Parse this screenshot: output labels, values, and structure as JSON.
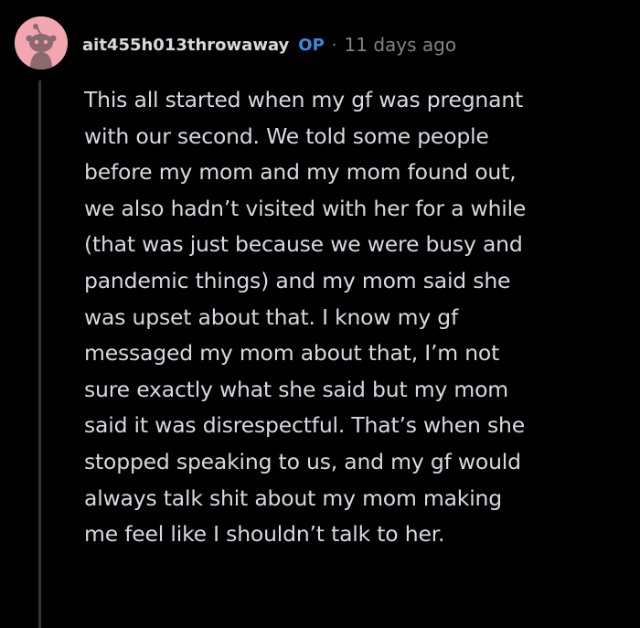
{
  "comment": {
    "username": "ait455h013throwaway",
    "op_badge": "OP",
    "separator": "·",
    "timestamp": "11 days ago",
    "avatar_icon": "snoo-avatar-icon",
    "colors": {
      "background": "#000000",
      "text": "#d7dadc",
      "op_badge": "#3a8be0",
      "meta_muted": "#818384",
      "avatar_bg": "#f2a7b0",
      "thread_line": "#343536"
    },
    "body_lines": [
      "This all started when my gf was pregnant",
      "with our second. We told some people",
      "before my mom and my mom found out,",
      "we also hadn’t visited with her for a while",
      "(that was just because we were busy and",
      "pandemic things) and my mom said she",
      "was upset about that. I know my gf",
      "messaged my mom about that, I’m not",
      "sure exactly what she said but my mom",
      "said it was disrespectful. That’s when she",
      "stopped speaking to us, and my gf would",
      "always talk shit about my mom making",
      "me feel like I shouldn’t talk to her."
    ]
  }
}
